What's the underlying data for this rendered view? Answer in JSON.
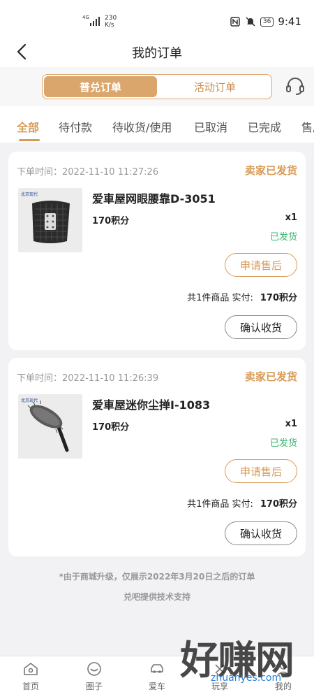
{
  "status_bar": {
    "network": "4G",
    "speed_value": "230",
    "speed_unit": "K/s",
    "battery": "36",
    "time": "9:41"
  },
  "nav": {
    "title": "我的订单"
  },
  "segment": {
    "items": [
      "普兑订单",
      "活动订单"
    ],
    "active_index": 0
  },
  "tabs": {
    "items": [
      "全部",
      "待付款",
      "待收货/使用",
      "已取消",
      "已完成",
      "售后"
    ],
    "active_index": 0
  },
  "orders": [
    {
      "time_label": "下单时间：",
      "time": "2022-11-10 11:27:26",
      "status": "卖家已发货",
      "image_brand": "北京现代",
      "product_name": "爱車屋网眼腰靠D-3051",
      "price": "170积分",
      "qty": "x1",
      "ship_status": "已发货",
      "after_sale_label": "申请售后",
      "summary_count": "共1件商品 实付:",
      "summary_amount": "170积分",
      "confirm_label": "确认收货"
    },
    {
      "time_label": "下单时间：",
      "time": "2022-11-10 11:26:39",
      "status": "卖家已发货",
      "image_brand": "北京现代",
      "product_name": "爱車屋迷你尘掸I-1083",
      "price": "170积分",
      "qty": "x1",
      "ship_status": "已发货",
      "after_sale_label": "申请售后",
      "summary_count": "共1件商品 实付:",
      "summary_amount": "170积分",
      "confirm_label": "确认收货"
    }
  ],
  "footer": {
    "notice": "*由于商城升级，仅展示2022年3月20日之后的订单",
    "tech": "兑吧提供技术支持"
  },
  "bottom_nav": {
    "items": [
      {
        "label": "首页",
        "icon": "home-icon"
      },
      {
        "label": "圈子",
        "icon": "circle-icon"
      },
      {
        "label": "爱车",
        "icon": "car-icon"
      },
      {
        "label": "玩享",
        "icon": "play-icon"
      },
      {
        "label": "我的",
        "icon": "user-icon"
      }
    ]
  },
  "watermark": {
    "text": "好赚网",
    "url": "zhuanyes.com"
  },
  "colors": {
    "accent": "#d89a55",
    "ship_green": "#3cb371"
  }
}
